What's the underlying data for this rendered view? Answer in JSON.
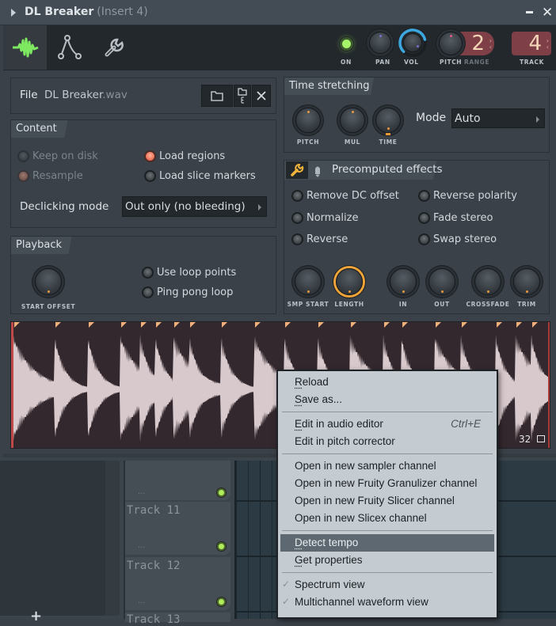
{
  "window": {
    "title": "DL Breaker",
    "subtitle": "(Insert 4)",
    "minimize_label": "minimize",
    "close_glyph": "✕"
  },
  "toolbar": {
    "tabs": [
      {
        "id": "sample",
        "icon": "waveform-icon",
        "active": true
      },
      {
        "id": "envelope",
        "icon": "envelope-icon",
        "active": false
      },
      {
        "id": "misc",
        "icon": "wrench-icon",
        "active": false
      }
    ],
    "controls": {
      "on_label": "ON",
      "pan_label": "PAN",
      "vol_label": "VOL",
      "pitch_label": "PITCH",
      "range_label": "RANGE",
      "range_value": "2",
      "track_label": "TRACK",
      "track_value": "4",
      "vol_level": 0.78
    },
    "colors": {
      "led_on": "#a6f46a",
      "vol_ring": "#3da8e0",
      "numbox": "#7e3f47"
    }
  },
  "file": {
    "label": "File",
    "name": "DL Breaker",
    "ext": ".wav"
  },
  "content": {
    "title": "Content",
    "options": [
      {
        "label": "Keep on disk",
        "state": "disabled-off"
      },
      {
        "label": "Resample",
        "state": "disabled-on"
      },
      {
        "label": "Load regions",
        "state": "on"
      },
      {
        "label": "Load slice markers",
        "state": "off"
      }
    ],
    "declicking_label": "Declicking mode",
    "declicking_value": "Out only (no bleeding)"
  },
  "playback": {
    "title": "Playback",
    "knob_label": "START OFFSET",
    "options": [
      {
        "label": "Use loop points",
        "state": "off"
      },
      {
        "label": "Ping pong loop",
        "state": "off"
      }
    ]
  },
  "time_stretching": {
    "title": "Time stretching",
    "knobs": [
      "PITCH",
      "MUL",
      "TIME"
    ],
    "mode_label": "Mode",
    "mode_value": "Auto"
  },
  "precomputed": {
    "title": "Precomputed effects",
    "options": [
      {
        "label": "Remove DC offset",
        "state": "off"
      },
      {
        "label": "Reverse polarity",
        "state": "off"
      },
      {
        "label": "Normalize",
        "state": "off"
      },
      {
        "label": "Fade stereo",
        "state": "off"
      },
      {
        "label": "Reverse",
        "state": "off"
      },
      {
        "label": "Swap stereo",
        "state": "off"
      }
    ],
    "knobs": [
      "SMP START",
      "LENGTH",
      "IN",
      "OUT",
      "CROSSFADE",
      "TRIM"
    ]
  },
  "waveform": {
    "zoom_value": "32",
    "colors": {
      "bg": "#33282d",
      "wave": "#d8c9cc",
      "marker": "#f0b07a"
    }
  },
  "tracks": [
    {
      "name": "",
      "dots": "..."
    },
    {
      "name": "Track 11",
      "dots": "..."
    },
    {
      "name": "Track 12",
      "dots": "..."
    },
    {
      "name": "Track 13",
      "dots": ""
    }
  ],
  "add_button": "+",
  "context_menu": {
    "groups": [
      [
        {
          "label": "Reload",
          "underline": "R"
        },
        {
          "label": "Save as...",
          "underline": "S"
        }
      ],
      [
        {
          "label": "Edit in audio editor",
          "shortcut": "Ctrl+E",
          "underline": "E"
        },
        {
          "label": "Edit in pitch corrector"
        }
      ],
      [
        {
          "label": "Open in new sampler channel"
        },
        {
          "label": "Open in new Fruity Granulizer channel"
        },
        {
          "label": "Open in new Fruity Slicer channel"
        },
        {
          "label": "Open in new Slicex channel"
        }
      ],
      [
        {
          "label": "Detect tempo",
          "highlighted": true,
          "underline": "D"
        },
        {
          "label": "Get properties",
          "underline": "G"
        }
      ],
      [
        {
          "label": "Spectrum view",
          "checked": true
        },
        {
          "label": "Multichannel waveform view",
          "checked": true
        }
      ]
    ]
  }
}
